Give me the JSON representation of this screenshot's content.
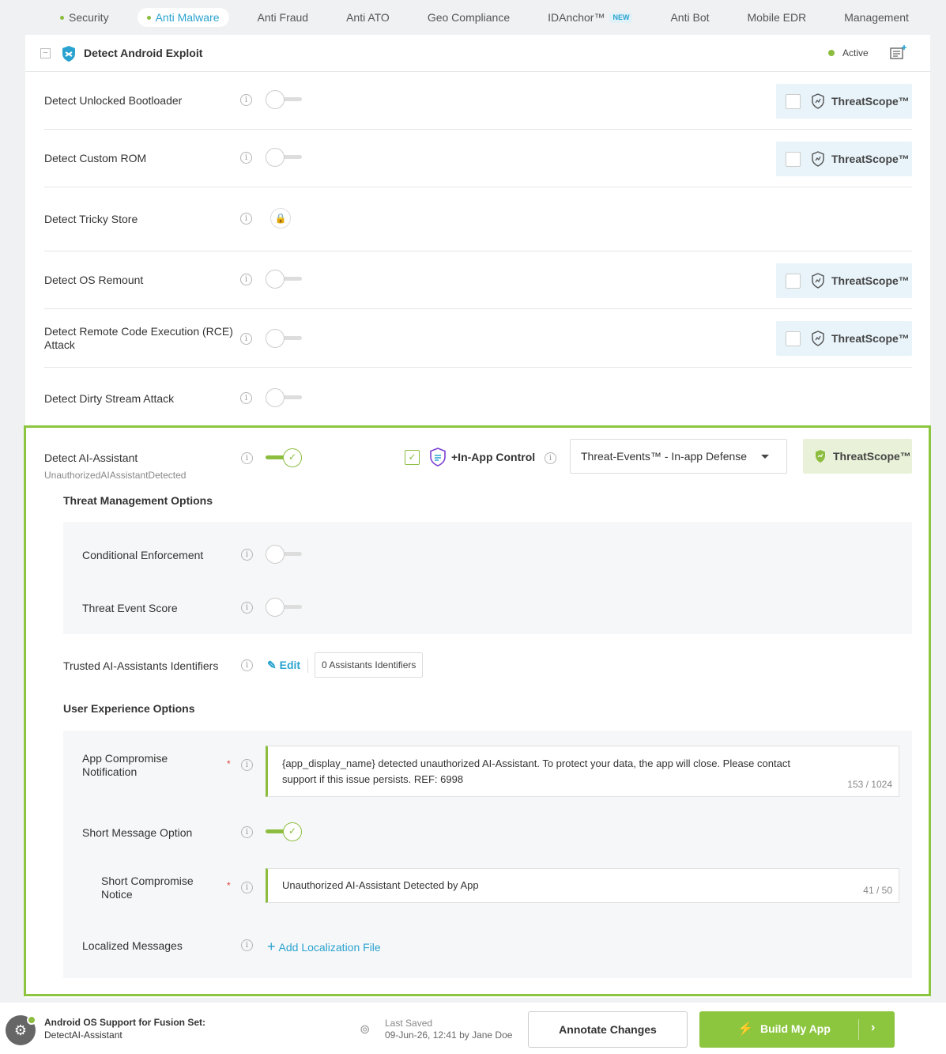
{
  "tabs": [
    {
      "label": "Security",
      "dot": true,
      "active": false
    },
    {
      "label": "Anti Malware",
      "dot": true,
      "active": true
    },
    {
      "label": "Anti Fraud",
      "dot": false,
      "active": false
    },
    {
      "label": "Anti ATO",
      "dot": false,
      "active": false
    },
    {
      "label": "Geo Compliance",
      "dot": false,
      "active": false
    },
    {
      "label": "IDAnchor™",
      "badge": "NEW",
      "active": false
    },
    {
      "label": "Anti Bot",
      "dot": false,
      "active": false
    },
    {
      "label": "Mobile EDR",
      "dot": false,
      "active": false
    },
    {
      "label": "Management",
      "dot": false,
      "active": false
    }
  ],
  "panel": {
    "title": "Detect Android Exploit",
    "collapse_symbol": "−",
    "status": "Active"
  },
  "rows": [
    {
      "label": "Detect Unlocked Bootloader",
      "enabled": false,
      "threatscope": "ThreatScope™"
    },
    {
      "label": "Detect Custom ROM",
      "enabled": false,
      "threatscope": "ThreatScope™"
    },
    {
      "label": "Detect Tricky Store",
      "locked": true,
      "lock_symbol": "🔒"
    },
    {
      "label": "Detect OS Remount",
      "enabled": false,
      "threatscope": "ThreatScope™"
    },
    {
      "label": "Detect Remote Code Execution (RCE) Attack",
      "enabled": false,
      "threatscope": "ThreatScope™"
    },
    {
      "label": "Detect Dirty Stream Attack",
      "enabled": false
    }
  ],
  "ai": {
    "label": "Detect AI-Assistant",
    "sublabel": "UnauthorizedAIAssistantDetected",
    "enabled": true,
    "check": "✓",
    "in_app_checked": true,
    "in_app_label": "+In-App Control",
    "select_value": "Threat-Events™ - In-app Defense",
    "threatscope": "ThreatScope™",
    "threat_mgmt_heading": "Threat Management Options",
    "conditional": "Conditional Enforcement",
    "score": "Threat Event Score",
    "trusted_label": "Trusted AI-Assistants Identifiers",
    "edit_icon": "✎",
    "edit": "Edit",
    "identifiers": "0 Assistants Identifiers",
    "ux_heading": "User Experience Options",
    "notif_label": "App Compromise Notification",
    "required_mark": "*",
    "notif_text": "{app_display_name} detected unauthorized AI-Assistant. To protect your data, the app will close. Please contact support if this issue persists. REF: 6998",
    "notif_count": "153 / 1024",
    "short_opt": "Short Message Option",
    "short_label": "Short Compromise Notice",
    "short_text": "Unauthorized AI-Assistant Detected by App",
    "short_count": "41 / 50",
    "local_label": "Localized Messages",
    "add_icon": "+",
    "add_loc": "Add Localization File"
  },
  "info_glyph": "i",
  "footer": {
    "avatar_glyph": "⚙",
    "title": "Android OS Support for Fusion Set:",
    "sub": "DetectAI-Assistant",
    "saved_icon": "⊚",
    "saved_label": "Last Saved",
    "saved_when": "09-Jun-26, 12:41 by Jane Doe",
    "annotate": "Annotate Changes",
    "build_icon": "⚡",
    "build": "Build My App",
    "arrow": "›"
  },
  "colors": {
    "accent": "#8cc63f",
    "link": "#2aa3d0"
  }
}
